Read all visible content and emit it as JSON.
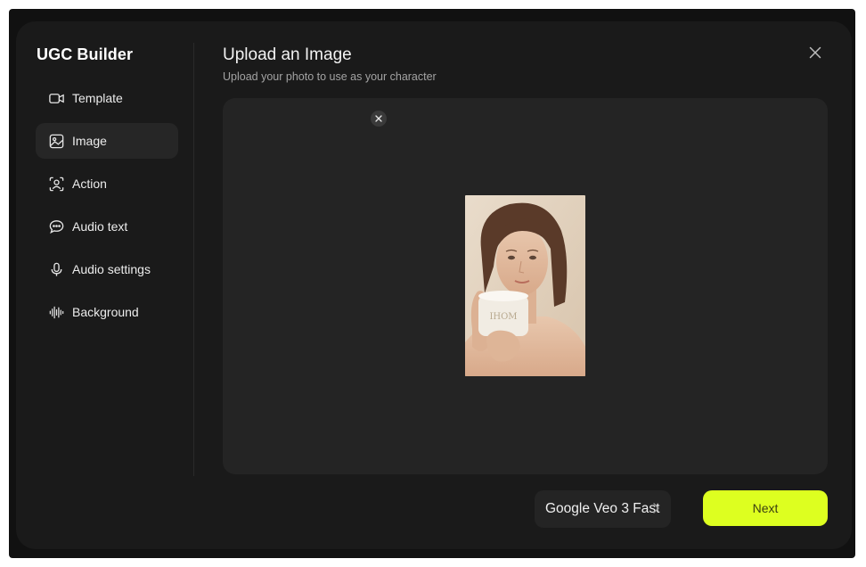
{
  "app": {
    "title": "UGC Builder"
  },
  "sidebar": {
    "items": [
      {
        "label": "Template",
        "icon": "video-icon"
      },
      {
        "label": "Image",
        "icon": "image-icon",
        "active": true
      },
      {
        "label": "Action",
        "icon": "person-scan-icon"
      },
      {
        "label": "Audio text",
        "icon": "chat-bubble-icon"
      },
      {
        "label": "Audio settings",
        "icon": "microphone-icon"
      },
      {
        "label": "Background",
        "icon": "waveform-icon"
      }
    ]
  },
  "header": {
    "title": "Upload an Image",
    "subtitle": "Upload your photo to use as your character"
  },
  "upload": {
    "jar_label": "IHOM"
  },
  "footer": {
    "model_label": "Google Veo 3 Fast",
    "next_label": "Next"
  },
  "colors": {
    "background": "#1a1a1a",
    "panel": "#242424",
    "accent": "#ddff20",
    "text": "#ececec"
  }
}
